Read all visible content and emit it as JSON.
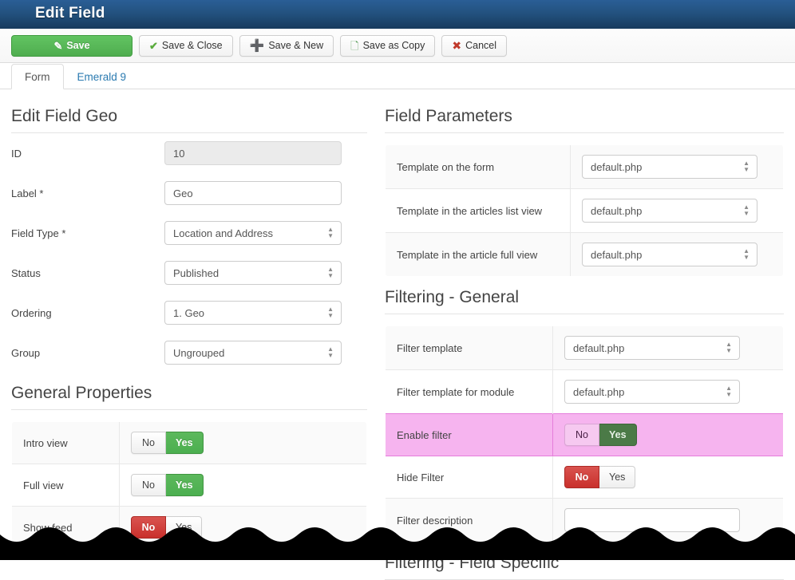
{
  "window": {
    "title": "Edit Field"
  },
  "toolbar": {
    "buttons": [
      {
        "label": "Save",
        "icon": "edit-icon",
        "style": "primary"
      },
      {
        "label": "Save & Close",
        "icon": "check-icon",
        "style": "default"
      },
      {
        "label": "Save & New",
        "icon": "plus-icon",
        "style": "default"
      },
      {
        "label": "Save as Copy",
        "icon": "copy-icon",
        "style": "default"
      },
      {
        "label": "Cancel",
        "icon": "cancel-icon",
        "style": "default"
      }
    ]
  },
  "tabs": [
    {
      "label": "Form",
      "active": true
    },
    {
      "label": "Emerald 9",
      "active": false
    }
  ],
  "left": {
    "heading": "Edit Field Geo",
    "fields": [
      {
        "label": "ID",
        "value": "10",
        "type": "text",
        "disabled": true
      },
      {
        "label": "Label *",
        "value": "Geo",
        "type": "text",
        "disabled": false
      },
      {
        "label": "Field Type *",
        "value": "Location and Address",
        "type": "select",
        "disabled": false
      },
      {
        "label": "Status",
        "value": "Published",
        "type": "select",
        "disabled": false
      },
      {
        "label": "Ordering",
        "value": "1. Geo",
        "type": "select",
        "disabled": false
      },
      {
        "label": "Group",
        "value": "Ungrouped",
        "type": "select",
        "disabled": false
      }
    ],
    "general_properties": {
      "heading": "General Properties",
      "rows": [
        {
          "label": "Intro view",
          "no": "No",
          "yes": "Yes",
          "selected": "yes"
        },
        {
          "label": "Full view",
          "no": "No",
          "yes": "Yes",
          "selected": "yes"
        },
        {
          "label": "Show feed",
          "no": "No",
          "yes": "Yes",
          "selected": "no"
        }
      ]
    }
  },
  "right": {
    "field_parameters": {
      "heading": "Field Parameters",
      "rows": [
        {
          "label": "Template on the form",
          "value": "default.php"
        },
        {
          "label": "Template in the articles list view",
          "value": "default.php"
        },
        {
          "label": "Template in the article full view",
          "value": "default.php"
        }
      ]
    },
    "filtering_general": {
      "heading": "Filtering - General",
      "rows": [
        {
          "label": "Filter template",
          "type": "select",
          "value": "default.php"
        },
        {
          "label": "Filter template for module",
          "type": "select",
          "value": "default.php"
        },
        {
          "label": "Enable filter",
          "type": "toggle",
          "no": "No",
          "yes": "Yes",
          "selected": "yes",
          "highlighted": true
        },
        {
          "label": "Hide Filter",
          "type": "toggle",
          "no": "No",
          "yes": "Yes",
          "selected": "no"
        },
        {
          "label": "Filter description",
          "type": "text",
          "value": ""
        }
      ]
    },
    "filtering_field_specific": {
      "heading": "Filtering - Field Specific"
    }
  },
  "colors": {
    "titlebar_top": "#2a5e96",
    "titlebar_bottom": "#173b5e",
    "primary_green": "#4fad4f",
    "danger_red": "#c9302c",
    "link_blue": "#2a7ab0",
    "highlight_pink": "#f6b4ef",
    "highlight_pink_border": "#e57ddb",
    "pressed_green": "#4b7a47"
  }
}
